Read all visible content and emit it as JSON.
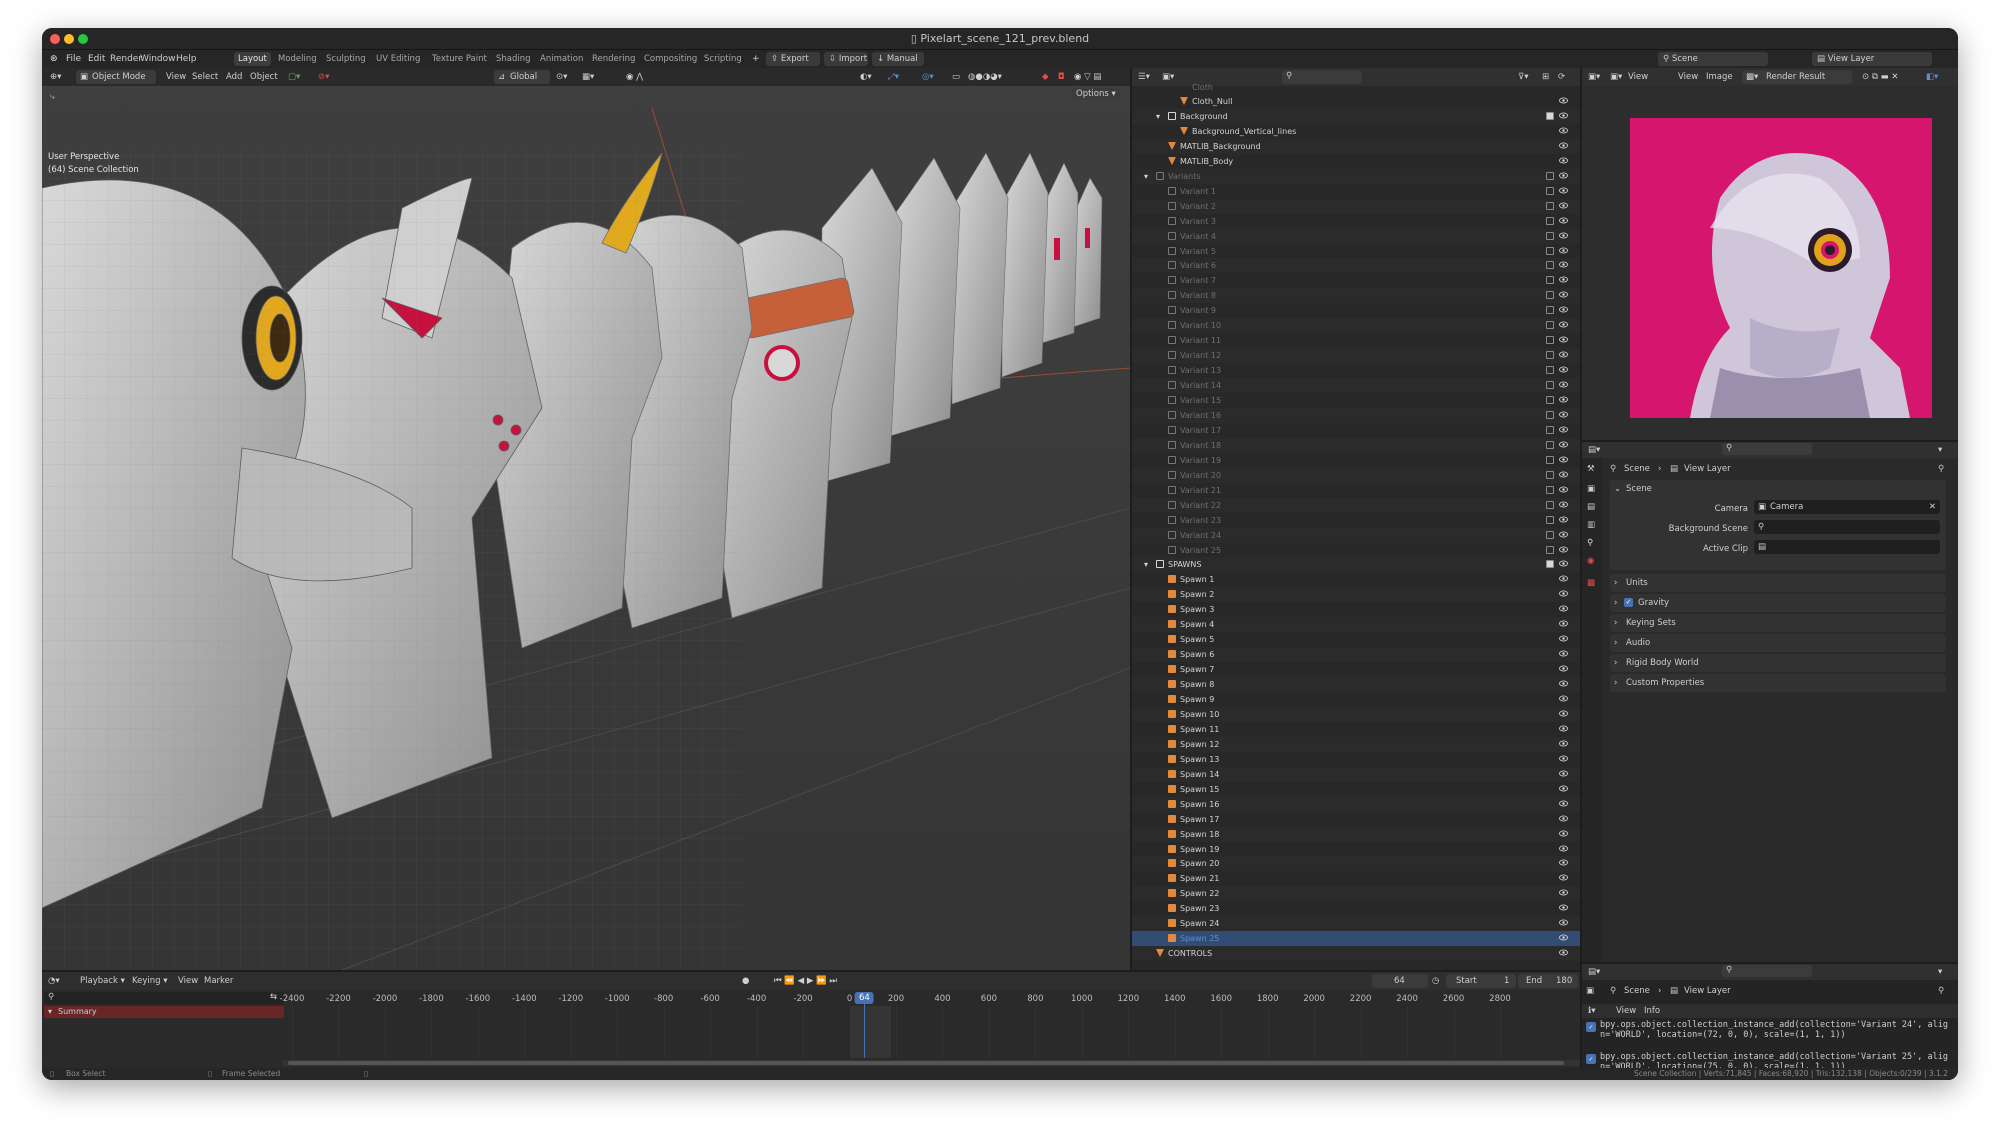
{
  "window": {
    "title": "Pixelart_scene_121_prev.blend"
  },
  "menu": {
    "items": [
      "File",
      "Edit",
      "Render",
      "Window",
      "Help"
    ]
  },
  "workspaces": [
    "Layout",
    "Modeling",
    "Sculpting",
    "UV Editing",
    "Texture Paint",
    "Shading",
    "Animation",
    "Rendering",
    "Compositing",
    "Scripting"
  ],
  "workspace_active": "Layout",
  "addon_buttons": {
    "export": "Export",
    "import": "Import",
    "manual": "Manual"
  },
  "scene_selector": {
    "scene": "Scene",
    "view_layer": "View Layer"
  },
  "viewport": {
    "mode": "Object Mode",
    "menu": [
      "View",
      "Select",
      "Add",
      "Object"
    ],
    "orientation": "Global",
    "options": "Options",
    "overlay_line1": "User Perspective",
    "overlay_line2": "(64) Scene Collection"
  },
  "outliner": {
    "top_partial": "Cloth",
    "rows": [
      {
        "label": "Cloth_Null",
        "depth": 2,
        "icon": "cone",
        "dim": false
      },
      {
        "label": "Background",
        "depth": 1,
        "icon": "collection",
        "check": true,
        "expand": true
      },
      {
        "label": "Background_Vertical_lines",
        "depth": 2,
        "icon": "cone"
      },
      {
        "label": "MATLIB_Background",
        "depth": 1,
        "icon": "cone"
      },
      {
        "label": "MATLIB_Body",
        "depth": 1,
        "icon": "cone"
      },
      {
        "label": "Variants",
        "depth": 0,
        "icon": "collection",
        "dim": true,
        "expand": true,
        "check": false
      },
      {
        "label": "Variant 1",
        "depth": 1,
        "icon": "collection",
        "dim": true
      },
      {
        "label": "Variant 2",
        "depth": 1,
        "icon": "collection",
        "dim": true
      },
      {
        "label": "Variant 3",
        "depth": 1,
        "icon": "collection",
        "dim": true
      },
      {
        "label": "Variant 4",
        "depth": 1,
        "icon": "collection",
        "dim": true
      },
      {
        "label": "Variant 5",
        "depth": 1,
        "icon": "collection",
        "dim": true
      },
      {
        "label": "Variant 6",
        "depth": 1,
        "icon": "collection",
        "dim": true
      },
      {
        "label": "Variant 7",
        "depth": 1,
        "icon": "collection",
        "dim": true
      },
      {
        "label": "Variant 8",
        "depth": 1,
        "icon": "collection",
        "dim": true
      },
      {
        "label": "Variant 9",
        "depth": 1,
        "icon": "collection",
        "dim": true
      },
      {
        "label": "Variant 10",
        "depth": 1,
        "icon": "collection",
        "dim": true
      },
      {
        "label": "Variant 11",
        "depth": 1,
        "icon": "collection",
        "dim": true
      },
      {
        "label": "Variant 12",
        "depth": 1,
        "icon": "collection",
        "dim": true
      },
      {
        "label": "Variant 13",
        "depth": 1,
        "icon": "collection",
        "dim": true
      },
      {
        "label": "Variant 14",
        "depth": 1,
        "icon": "collection",
        "dim": true
      },
      {
        "label": "Variant 15",
        "depth": 1,
        "icon": "collection",
        "dim": true
      },
      {
        "label": "Variant 16",
        "depth": 1,
        "icon": "collection",
        "dim": true
      },
      {
        "label": "Variant 17",
        "depth": 1,
        "icon": "collection",
        "dim": true
      },
      {
        "label": "Variant 18",
        "depth": 1,
        "icon": "collection",
        "dim": true
      },
      {
        "label": "Variant 19",
        "depth": 1,
        "icon": "collection",
        "dim": true
      },
      {
        "label": "Variant 20",
        "depth": 1,
        "icon": "collection",
        "dim": true
      },
      {
        "label": "Variant 21",
        "depth": 1,
        "icon": "collection",
        "dim": true
      },
      {
        "label": "Variant 22",
        "depth": 1,
        "icon": "collection",
        "dim": true
      },
      {
        "label": "Variant 23",
        "depth": 1,
        "icon": "collection",
        "dim": true
      },
      {
        "label": "Variant 24",
        "depth": 1,
        "icon": "collection",
        "dim": true
      },
      {
        "label": "Variant 25",
        "depth": 1,
        "icon": "collection",
        "dim": true
      },
      {
        "label": "SPAWNS",
        "depth": 0,
        "icon": "collection",
        "check": true,
        "expand": true
      },
      {
        "label": "Spawn 1",
        "depth": 1,
        "icon": "spawn"
      },
      {
        "label": "Spawn 2",
        "depth": 1,
        "icon": "spawn"
      },
      {
        "label": "Spawn 3",
        "depth": 1,
        "icon": "spawn"
      },
      {
        "label": "Spawn 4",
        "depth": 1,
        "icon": "spawn"
      },
      {
        "label": "Spawn 5",
        "depth": 1,
        "icon": "spawn"
      },
      {
        "label": "Spawn 6",
        "depth": 1,
        "icon": "spawn"
      },
      {
        "label": "Spawn 7",
        "depth": 1,
        "icon": "spawn"
      },
      {
        "label": "Spawn 8",
        "depth": 1,
        "icon": "spawn"
      },
      {
        "label": "Spawn 9",
        "depth": 1,
        "icon": "spawn"
      },
      {
        "label": "Spawn 10",
        "depth": 1,
        "icon": "spawn"
      },
      {
        "label": "Spawn 11",
        "depth": 1,
        "icon": "spawn"
      },
      {
        "label": "Spawn 12",
        "depth": 1,
        "icon": "spawn"
      },
      {
        "label": "Spawn 13",
        "depth": 1,
        "icon": "spawn"
      },
      {
        "label": "Spawn 14",
        "depth": 1,
        "icon": "spawn"
      },
      {
        "label": "Spawn 15",
        "depth": 1,
        "icon": "spawn"
      },
      {
        "label": "Spawn 16",
        "depth": 1,
        "icon": "spawn"
      },
      {
        "label": "Spawn 17",
        "depth": 1,
        "icon": "spawn"
      },
      {
        "label": "Spawn 18",
        "depth": 1,
        "icon": "spawn"
      },
      {
        "label": "Spawn 19",
        "depth": 1,
        "icon": "spawn"
      },
      {
        "label": "Spawn 20",
        "depth": 1,
        "icon": "spawn"
      },
      {
        "label": "Spawn 21",
        "depth": 1,
        "icon": "spawn"
      },
      {
        "label": "Spawn 22",
        "depth": 1,
        "icon": "spawn"
      },
      {
        "label": "Spawn 23",
        "depth": 1,
        "icon": "spawn"
      },
      {
        "label": "Spawn 24",
        "depth": 1,
        "icon": "spawn"
      },
      {
        "label": "Spawn 25",
        "depth": 1,
        "icon": "spawn",
        "selected": true
      },
      {
        "label": "CONTROLS",
        "depth": 0,
        "icon": "cone"
      }
    ]
  },
  "image_editor": {
    "menu": [
      "View",
      "View",
      "Image"
    ],
    "image_name": "Render Result"
  },
  "properties": {
    "breadcrumb_scene": "Scene",
    "breadcrumb_layer": "View Layer",
    "panel": "Scene",
    "camera_label": "Camera",
    "camera_value": "Camera",
    "background_label": "Background Scene",
    "clip_label": "Active Clip",
    "sections": [
      "Units",
      "Gravity",
      "Keying Sets",
      "Audio",
      "Rigid Body World",
      "Custom Properties"
    ],
    "gravity_checked": true
  },
  "info_editor": {
    "breadcrumb_scene": "Scene",
    "breadcrumb_layer": "View Layer",
    "menu": [
      "View",
      "Info"
    ],
    "log": [
      "bpy.ops.object.collection_instance_add(collection='Variant 24', align='WORLD', location=(72, 0, 0), scale=(1, 1, 1))",
      "bpy.ops.object.collection_instance_add(collection='Variant 25', align='WORLD', location=(75, 0, 0), scale=(1, 1, 1))"
    ]
  },
  "timeline": {
    "menu": [
      "Playback",
      "Keying",
      "View",
      "Marker"
    ],
    "summary": "Summary",
    "current_frame": "64",
    "start_label": "Start",
    "start_value": "1",
    "end_label": "End",
    "end_value": "180",
    "ticks": [
      "-2400",
      "-2200",
      "-2000",
      "-1800",
      "-1600",
      "-1400",
      "-1200",
      "-1000",
      "-800",
      "-600",
      "-400",
      "-200",
      "0",
      "200",
      "400",
      "600",
      "800",
      "1000",
      "1200",
      "1400",
      "1600",
      "1800",
      "2000",
      "2200",
      "2400",
      "2600",
      "2800"
    ],
    "playhead_label": "64"
  },
  "statusbar": {
    "left1": "Box Select",
    "left2": "Frame Selected",
    "right": "Scene Collection | Verts:71,845 | Faces:68,920 | Tris:132,138 | Objects:0/239 | 3.1.2"
  },
  "colors": {
    "accent": "#4772b3",
    "selected_row": "#334c74",
    "collection_icon": "#d8d8d8",
    "object_icon": "#e2893b",
    "render_bg": "#d6156f"
  }
}
